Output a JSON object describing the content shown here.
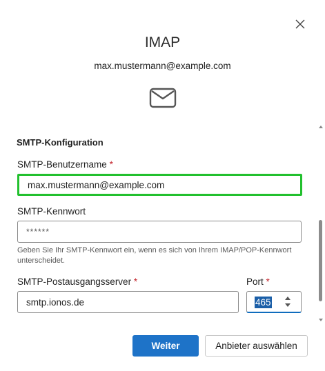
{
  "dialog": {
    "title": "IMAP",
    "account_email": "max.mustermann@example.com"
  },
  "icons": {
    "close": "close-icon",
    "mail": "envelope-icon"
  },
  "smtp": {
    "section_title": "SMTP-Konfiguration",
    "username": {
      "label": "SMTP-Benutzername",
      "required_mark": "*",
      "value": "max.mustermann@example.com"
    },
    "password": {
      "label": "SMTP-Kennwort",
      "value": "******",
      "hint": "Geben Sie Ihr SMTP-Kennwort ein, wenn es sich von Ihrem IMAP/POP-Kennwort unterscheidet."
    },
    "server": {
      "label": "SMTP-Postausgangsserver",
      "required_mark": "*",
      "value": "smtp.ionos.de"
    },
    "port": {
      "label": "Port",
      "required_mark": "*",
      "value": "465"
    }
  },
  "buttons": {
    "next": "Weiter",
    "choose_provider": "Anbieter auswählen"
  },
  "colors": {
    "primary": "#1e73c8",
    "highlight": "#22c02e",
    "required": "#c4262e"
  }
}
